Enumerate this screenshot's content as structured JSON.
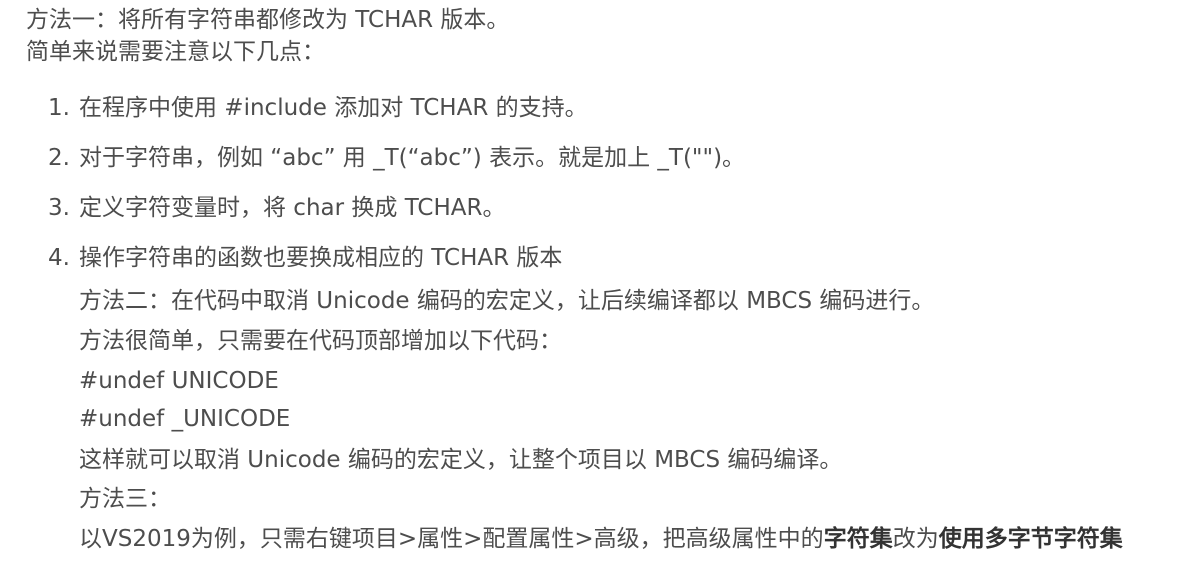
{
  "intro": {
    "line1": "方法一：将所有字符串都修改为 TCHAR 版本。",
    "line2": "简单来说需要注意以下几点："
  },
  "list": [
    {
      "num": "1.",
      "text": "在程序中使用 #include 添加对 TCHAR 的支持。"
    },
    {
      "num": "2.",
      "text": "对于字符串，例如 “abc” 用 _T(“abc”) 表示。就是加上 _T(\"\")。"
    },
    {
      "num": "3.",
      "text": "定义字符变量时，将 char 换成 TCHAR。"
    },
    {
      "num": "4.",
      "text": "操作字符串的函数也要换成相应的 TCHAR 版本"
    }
  ],
  "continuation": {
    "method2": "方法二：在代码中取消 Unicode 编码的宏定义，让后续编译都以 MBCS 编码进行。",
    "simple": "方法很简单，只需要在代码顶部增加以下代码：",
    "code1": "#undef UNICODE",
    "code2": "#undef _UNICODE",
    "result": "这样就可以取消 Unicode 编码的宏定义，让整个项目以 MBCS 编码编译。",
    "method3": "方法三：",
    "vs_pre": "以VS2019为例，只需右键项目>属性>配置属性>高级，把高级属性中的",
    "vs_bold1": "字符集",
    "vs_mid": "改为",
    "vs_bold2": "使用多字节字符集"
  }
}
